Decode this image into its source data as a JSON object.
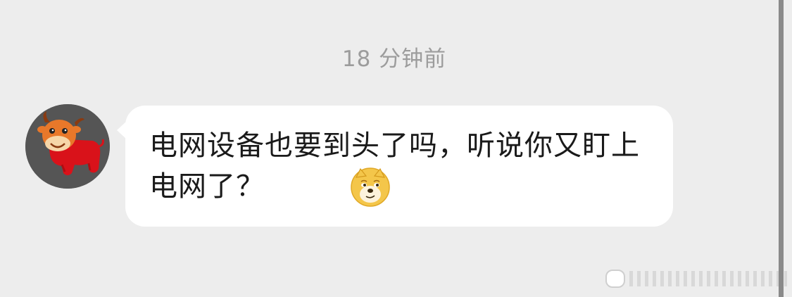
{
  "chat": {
    "timestamp": "18 分钟前",
    "message": {
      "text": "电网设备也要到头了吗，听说你又盯上电网了？",
      "emoji": "doge-icon",
      "bubble_color": "#ffffff"
    },
    "avatar": {
      "icon": "ox-cartoon-icon",
      "background": "#555555"
    }
  },
  "colors": {
    "background": "#ededed",
    "timestamp": "#9c9c9c",
    "text": "#1a1a1a"
  }
}
